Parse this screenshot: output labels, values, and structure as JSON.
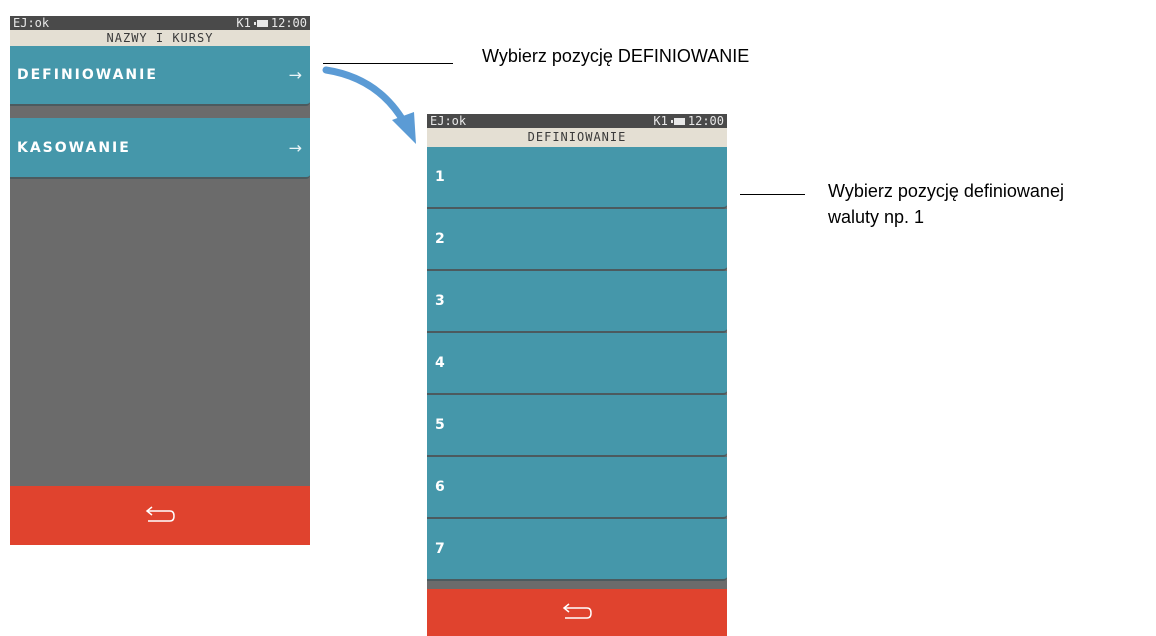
{
  "screen1": {
    "status": {
      "left": "EJ:ok",
      "keyboard": "K1",
      "time": "12:00"
    },
    "title": "NAZWY I KURSY",
    "items": [
      {
        "label": "DEFINIOWANIE",
        "arrow": "→"
      },
      {
        "label": "KASOWANIE",
        "arrow": "→"
      }
    ],
    "back_icon": "return-arrow-icon"
  },
  "screen2": {
    "status": {
      "left": "EJ:ok",
      "keyboard": "K1",
      "time": "12:00"
    },
    "title": "DEFINIOWANIE",
    "items": [
      {
        "label": "1"
      },
      {
        "label": "2"
      },
      {
        "label": "3"
      },
      {
        "label": "4"
      },
      {
        "label": "5"
      },
      {
        "label": "6"
      },
      {
        "label": "7"
      }
    ],
    "back_icon": "return-arrow-icon"
  },
  "annotations": {
    "step1": "Wybierz pozycję DEFINIOWANIE",
    "step2_line1": "Wybierz pozycję definiowanej",
    "step2_line2": "waluty np. 1"
  },
  "colors": {
    "menu_item": "#4597aa",
    "back_bar": "#e0432e",
    "screen_bg": "#6b6b6b",
    "title_bar": "#e4dfd3",
    "status_bar": "#4a4a4a",
    "flow_arrow": "#5b9bd5"
  }
}
